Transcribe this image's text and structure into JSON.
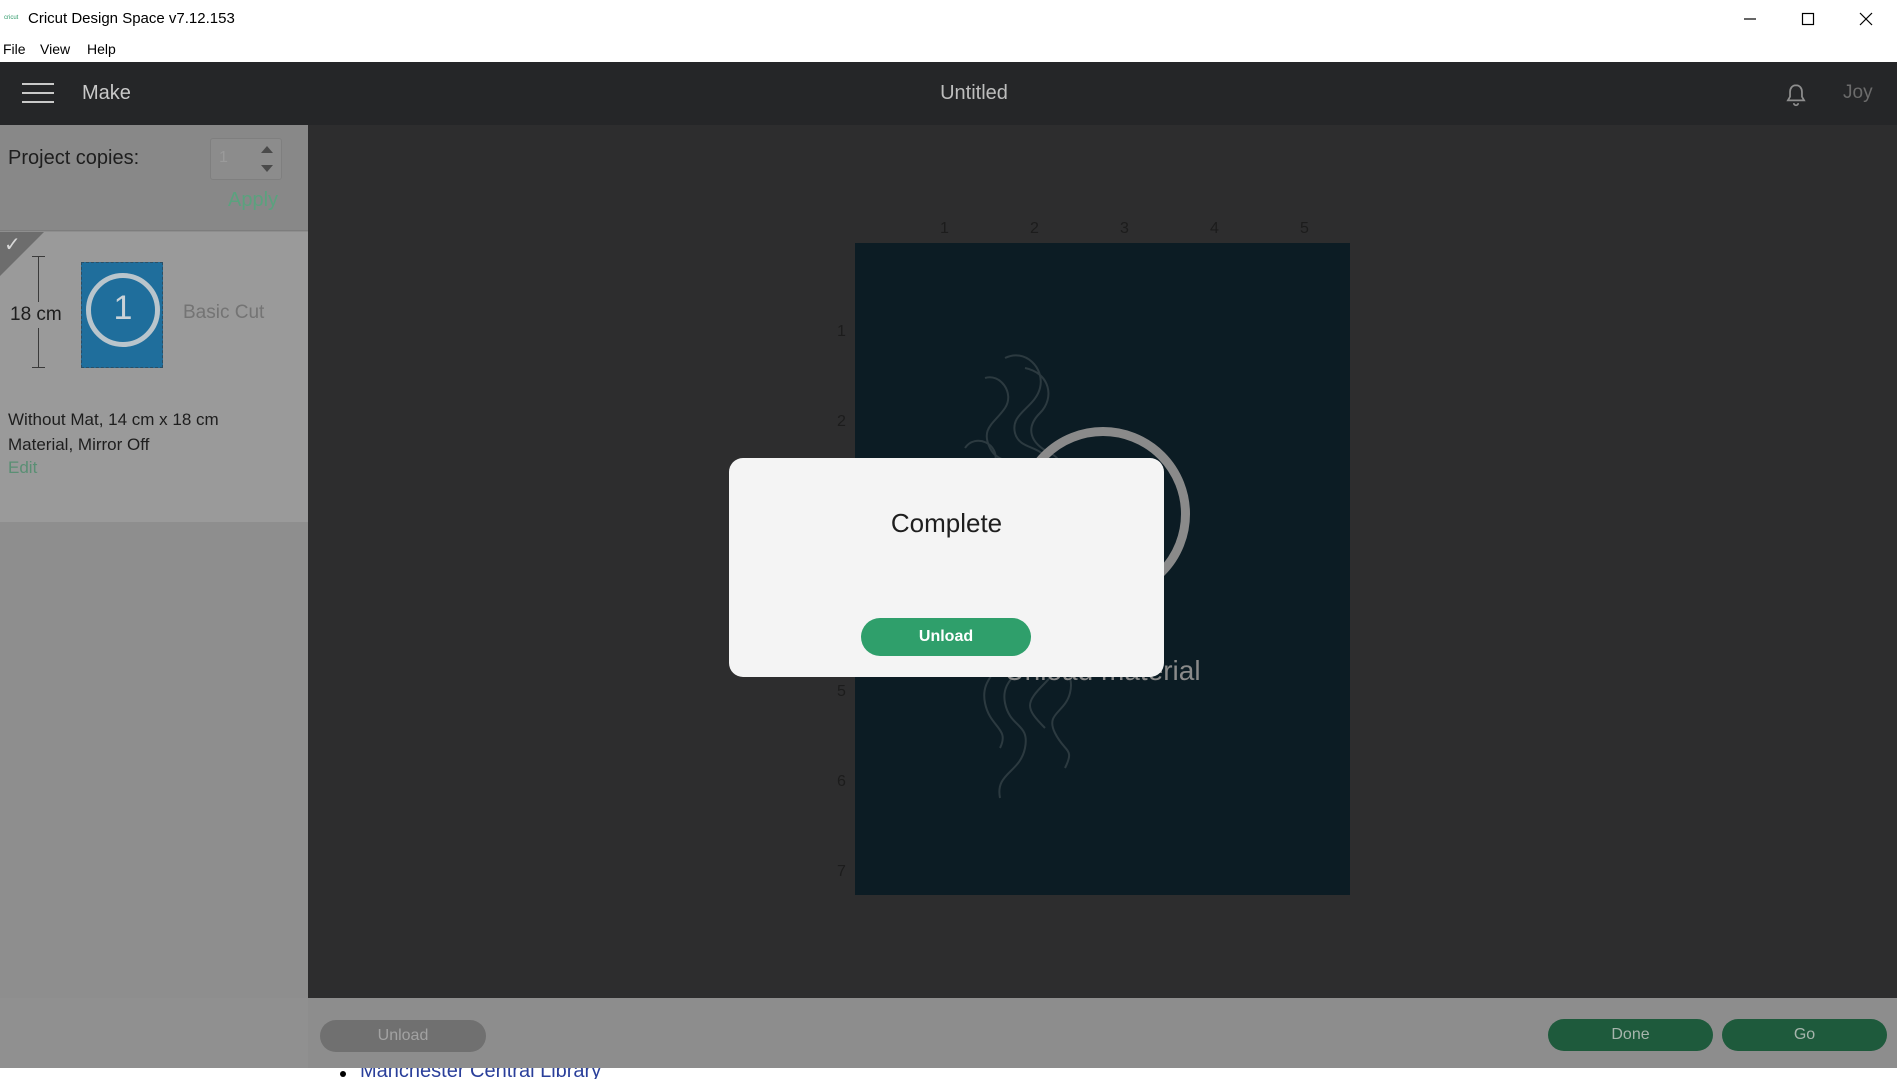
{
  "window": {
    "title": "Cricut Design Space  v7.12.153",
    "logo_text": "cricut"
  },
  "menu": [
    "File",
    "View",
    "Help"
  ],
  "header": {
    "section": "Make",
    "title": "Untitled",
    "user": "Joy"
  },
  "left_panel": {
    "copies_label": "Project copies:",
    "copies_value": "1",
    "apply_label": "Apply",
    "mat": {
      "height_label": "18 cm",
      "number": "1",
      "mode": "Basic Cut",
      "desc_line1": "Without Mat, 14 cm x 18 cm",
      "desc_line2": "Material, Mirror Off",
      "edit_label": "Edit"
    }
  },
  "canvas": {
    "ruler_x": [
      "1",
      "2",
      "3",
      "4",
      "5"
    ],
    "ruler_y": [
      "1",
      "2",
      "5",
      "6",
      "7"
    ],
    "overlay_text": "Unload material"
  },
  "dialog": {
    "title": "Complete",
    "button_label": "Unload"
  },
  "bottom_bar": {
    "unload_label": "Unload",
    "done_label": "Done",
    "go_label": "Go"
  },
  "below": {
    "link_text": "Manchester Central Library"
  },
  "colors": {
    "accent_green": "#2f9f6b",
    "header_bg": "#252628",
    "mat_blue": "#1f6e9c"
  }
}
